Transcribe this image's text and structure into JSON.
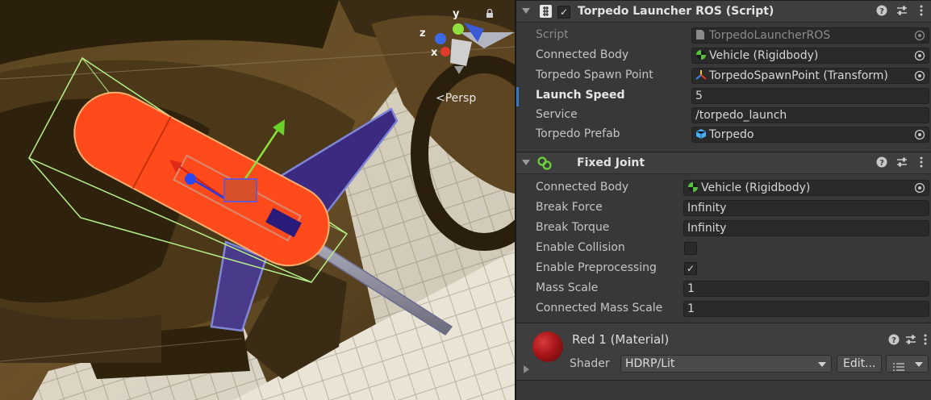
{
  "scene": {
    "persp_label": "Persp",
    "axis_labels": {
      "y": "y",
      "z": "z",
      "x": "x"
    }
  },
  "torpedo_launcher": {
    "title": "Torpedo Launcher ROS (Script)",
    "enabled": true,
    "icon": "script-hash-icon",
    "fields": [
      {
        "label": "Script",
        "value": "TorpedoLauncherROS",
        "icon": "script-file-icon",
        "disabled": true,
        "picker": true
      },
      {
        "label": "Connected Body",
        "value": "Vehicle (Rigidbody)",
        "icon": "rigidbody-icon",
        "picker": true
      },
      {
        "label": "Torpedo Spawn Point",
        "value": "TorpedoSpawnPoint (Transform)",
        "icon": "transform-icon",
        "picker": true
      },
      {
        "label": "Launch Speed",
        "value": "5",
        "modified": true
      },
      {
        "label": "Service",
        "value": "/torpedo_launch"
      },
      {
        "label": "Torpedo Prefab",
        "value": "Torpedo",
        "icon": "prefab-cube-icon",
        "picker": true
      }
    ]
  },
  "fixed_joint": {
    "title": "Fixed Joint",
    "icon": "fixed-joint-icon",
    "fields": [
      {
        "label": "Connected Body",
        "value": "Vehicle (Rigidbody)",
        "icon": "rigidbody-icon",
        "picker": true
      },
      {
        "label": "Break Force",
        "value": "Infinity"
      },
      {
        "label": "Break Torque",
        "value": "Infinity"
      },
      {
        "label": "Enable Collision",
        "checkbox": true,
        "checked": false
      },
      {
        "label": "Enable Preprocessing",
        "checkbox": true,
        "checked": true
      },
      {
        "label": "Mass Scale",
        "value": "1"
      },
      {
        "label": "Connected Mass Scale",
        "value": "1"
      }
    ]
  },
  "material": {
    "title": "Red 1 (Material)",
    "shader_label": "Shader",
    "shader_value": "HDRP/Lit",
    "edit_label": "Edit...",
    "swatch_color": "#a8161a"
  },
  "header_buttons": {
    "help": "?",
    "presets": "⇌",
    "more": "⋮"
  },
  "colors": {
    "accent": "#3a79bb",
    "torpedo_orange": "#ff4a1c",
    "fin_purple": "#3b2a80"
  }
}
